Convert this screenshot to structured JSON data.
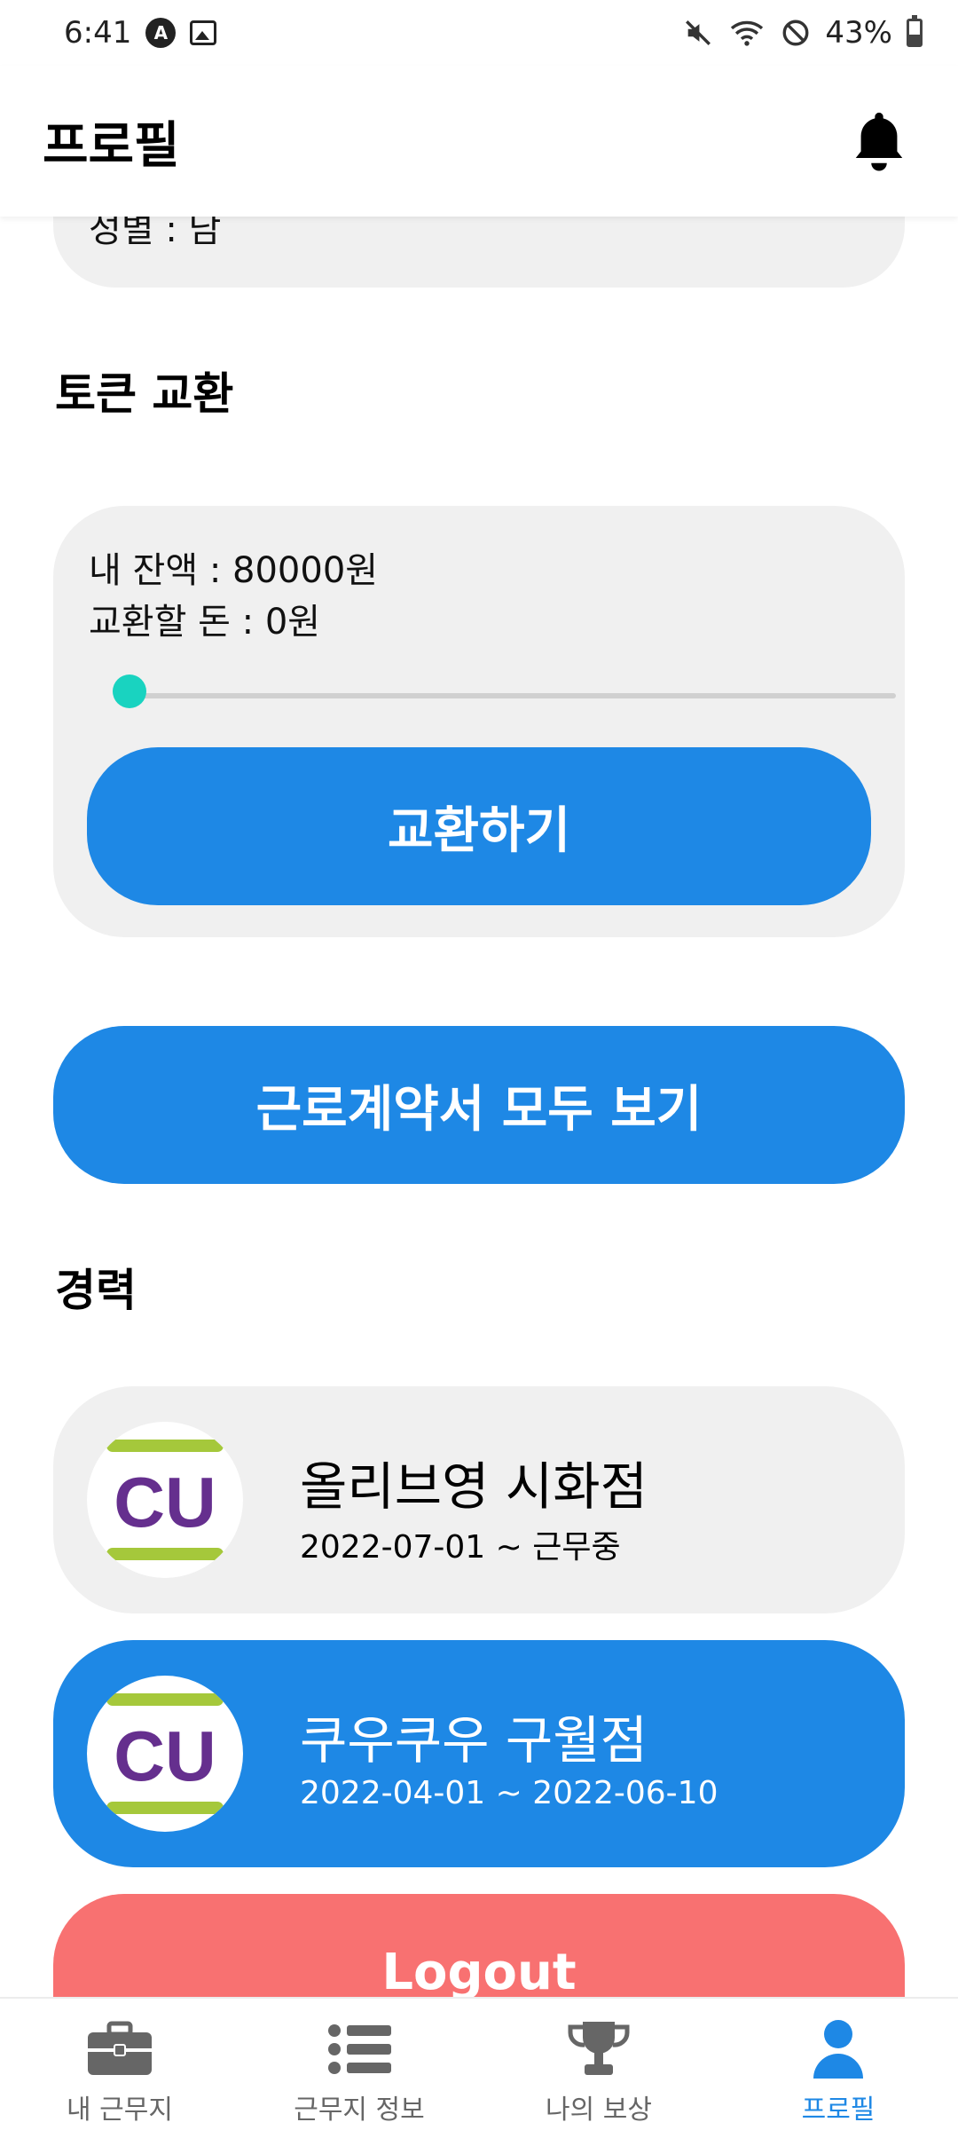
{
  "status_bar": {
    "time": "6:41",
    "notification_badge": "A",
    "battery_text": "43%",
    "battery_level": 0.43
  },
  "header": {
    "title": "프로필"
  },
  "prev_card": {
    "partial_text": "성별 : 남"
  },
  "token_section": {
    "title": "토큰 교환",
    "balance_text": "내 잔액 : 80000원",
    "exchange_amount_text": "교환할 돈 : 0원",
    "slider_value": 0,
    "exchange_button": "교환하기"
  },
  "contracts_button": "근로계약서 모두 보기",
  "career": {
    "title": "경력",
    "items": [
      {
        "name": "올리브영 시화점",
        "period": "2022-07-01 ~ 근무중",
        "logo_text": "CU"
      },
      {
        "name": "쿠우쿠우 구월점",
        "period": "2022-04-01 ~ 2022-06-10",
        "logo_text": "CU"
      }
    ]
  },
  "logout_button": "Logout",
  "bottom_nav": {
    "items": [
      {
        "label": "내 근무지",
        "icon": "briefcase-icon"
      },
      {
        "label": "근무지 정보",
        "icon": "list-icon"
      },
      {
        "label": "나의 보상",
        "icon": "trophy-icon"
      },
      {
        "label": "프로필",
        "icon": "user-icon",
        "active": true
      }
    ]
  },
  "colors": {
    "primary": "#1e88e5",
    "card_bg": "#f0f0f0",
    "slider_thumb": "#19d3c0",
    "logout": "#f87171",
    "logo_purple": "#652f8e",
    "logo_green": "#a5c83b"
  }
}
